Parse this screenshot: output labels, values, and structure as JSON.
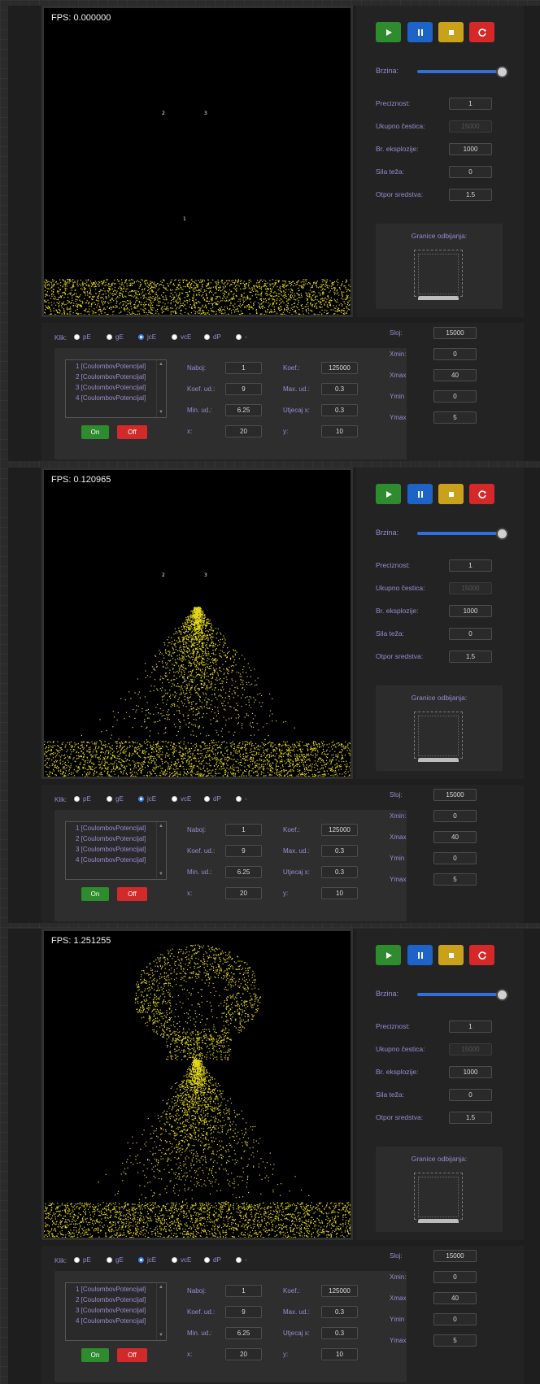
{
  "frames": [
    {
      "fps": "FPS: 0.000000",
      "scene": "flat"
    },
    {
      "fps": "FPS: 0.120965",
      "scene": "peak"
    },
    {
      "fps": "FPS: 1.251255",
      "scene": "mushroom"
    }
  ],
  "markers": {
    "m1": "1",
    "m2": "2",
    "m3": "3"
  },
  "colors": {
    "particle": "#e3d718",
    "play": "#2e8b2e",
    "pause": "#1e63c8",
    "stop": "#c9a21a",
    "reset": "#d62828",
    "accent_text": "#9b8ad0"
  },
  "controls": {
    "icons": [
      "play-icon",
      "pause-icon",
      "stop-icon",
      "reset-icon"
    ],
    "brzina_label": "Brzina:",
    "brzina_value": 1.0,
    "fields": [
      {
        "label": "Preciznost:",
        "value": "1",
        "disabled": false
      },
      {
        "label": "Ukupno čestica:",
        "value": "15000",
        "disabled": true
      },
      {
        "label": "Br. eksplozije:",
        "value": "1000",
        "disabled": false
      },
      {
        "label": "Sila teža:",
        "value": "0",
        "disabled": false
      },
      {
        "label": "Otpor sredstva:",
        "value": "1.5",
        "disabled": false
      }
    ],
    "bounds_title": "Granice odbijanja:"
  },
  "klik": {
    "label": "Klik:",
    "options": [
      "pE",
      "gE",
      "jcE",
      "vcE",
      "dP",
      "-"
    ],
    "selected": "jcE"
  },
  "list": {
    "items": [
      "1 [CoulombovPotencijal]",
      "2 [CoulombovPotencijal]",
      "3 [CoulombovPotencijal]",
      "4 [CoulombovPotencijal]"
    ]
  },
  "buttons": {
    "on": "On",
    "off": "Off"
  },
  "params": {
    "naboj_label": "Naboj:",
    "naboj": "1",
    "koef_label": "Koef.:",
    "koef": "125000",
    "koef_ud_label": "Koef. ud.:",
    "koef_ud": "9",
    "max_ud_label": "Max. ud.:",
    "max_ud": "0.3",
    "min_ud_label": "Min. ud.:",
    "min_ud": "6.25",
    "utjecaj_label": "Utjecaj x:",
    "utjecaj": "0.3",
    "x_label": "x:",
    "x": "20",
    "y_label": "y:",
    "y": "10"
  },
  "side": {
    "rows": [
      {
        "label": "Sloj:",
        "value": "15000"
      },
      {
        "label": "Xmin:",
        "value": "0"
      },
      {
        "label": "Xmax",
        "value": "40"
      },
      {
        "label": "Ymin",
        "value": "0"
      },
      {
        "label": "Ymax",
        "value": "5"
      }
    ]
  }
}
